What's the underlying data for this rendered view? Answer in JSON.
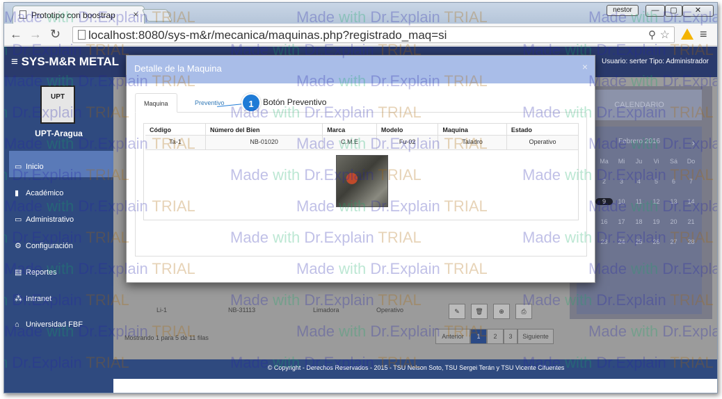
{
  "browser": {
    "tab_title": "Prototipo con boostrap",
    "tab_close": "×",
    "os_user": "nestor",
    "url": "localhost:8080/sys-m&r/mecanica/maquinas.php?registrado_maq=si",
    "controls": {
      "minimize": "—",
      "maximize": "▢",
      "close": "✕"
    }
  },
  "app": {
    "brand": "≡  SYS-M&R  METAL",
    "user_label": "Usuario: serter   Tipo: Administrador",
    "org_name": "UPT-Aragua",
    "logo_text": "UPT",
    "menu": [
      {
        "icon": "folder-icon",
        "glyph": "▭",
        "label": "Inicio",
        "active": true
      },
      {
        "icon": "book-icon",
        "glyph": "▮",
        "label": "Académico",
        "active": false
      },
      {
        "icon": "monitor-icon",
        "glyph": "▭",
        "label": "Administrativo",
        "active": false
      },
      {
        "icon": "gears-icon",
        "glyph": "⚙",
        "label": "Configuración",
        "active": false
      },
      {
        "icon": "report-icon",
        "glyph": "▤",
        "label": "Reportes",
        "active": false
      },
      {
        "icon": "network-icon",
        "glyph": "⁂",
        "label": "Intranet",
        "active": false
      },
      {
        "icon": "university-icon",
        "glyph": "⌂",
        "label": "Universidad FBF",
        "active": false
      }
    ],
    "footer": "© Copyright - Derechos Reservados - 2015 - TSU Nelson Soto, TSU Sergei Terán y TSU Vicente Cifuentes"
  },
  "calendar": {
    "header": "CALENDARIO",
    "month": "Febrero 2016",
    "prev": "‹",
    "next": "›",
    "weekdays": [
      "Lu",
      "Ma",
      "Mi",
      "Ju",
      "Vi",
      "Sá",
      "Do"
    ],
    "weeks": [
      [
        "1",
        "2",
        "3",
        "4",
        "5",
        "6",
        "7"
      ],
      [
        "8",
        "9",
        "10",
        "11",
        "12",
        "13",
        "14"
      ],
      [
        "15",
        "16",
        "17",
        "18",
        "19",
        "20",
        "21"
      ],
      [
        "22",
        "23",
        "24",
        "25",
        "26",
        "27",
        "28"
      ],
      [
        "29",
        "",
        "",
        "",
        "",
        "",
        ""
      ]
    ],
    "today": "9"
  },
  "background_table": {
    "last_row": {
      "codigo": "Li-1",
      "bien": "NB-31113",
      "maquina": "Limadora",
      "estado": "Operativo"
    },
    "showing": "Mostrando 1 para 5 de 11 filas",
    "pagination": {
      "prev": "Anterior",
      "pages": [
        "1",
        "2",
        "3"
      ],
      "next": "Siguiente",
      "active": "1"
    },
    "action_icons": {
      "edit": "✎",
      "delete": "🗑",
      "view": "⊕",
      "print": "⎙"
    }
  },
  "modal": {
    "title": "Detalle de la Maquina",
    "close": "×",
    "tabs": [
      "Maquina",
      "Preventivo"
    ],
    "active_tab": "Maquina",
    "callout": {
      "number": "1",
      "text": "Botón Preventivo"
    },
    "columns": [
      "Código",
      "Número del Bien",
      "Marca",
      "Modelo",
      "Maquina",
      "Estado"
    ],
    "row": [
      "Ta-1",
      "NB-01020",
      "C.M.E",
      "Fu-02",
      "Taladro",
      "Operativo"
    ]
  },
  "watermark": {
    "made": "Made",
    "with": "with",
    "explain": "Dr.Explain",
    "trial": "TRIAL"
  }
}
